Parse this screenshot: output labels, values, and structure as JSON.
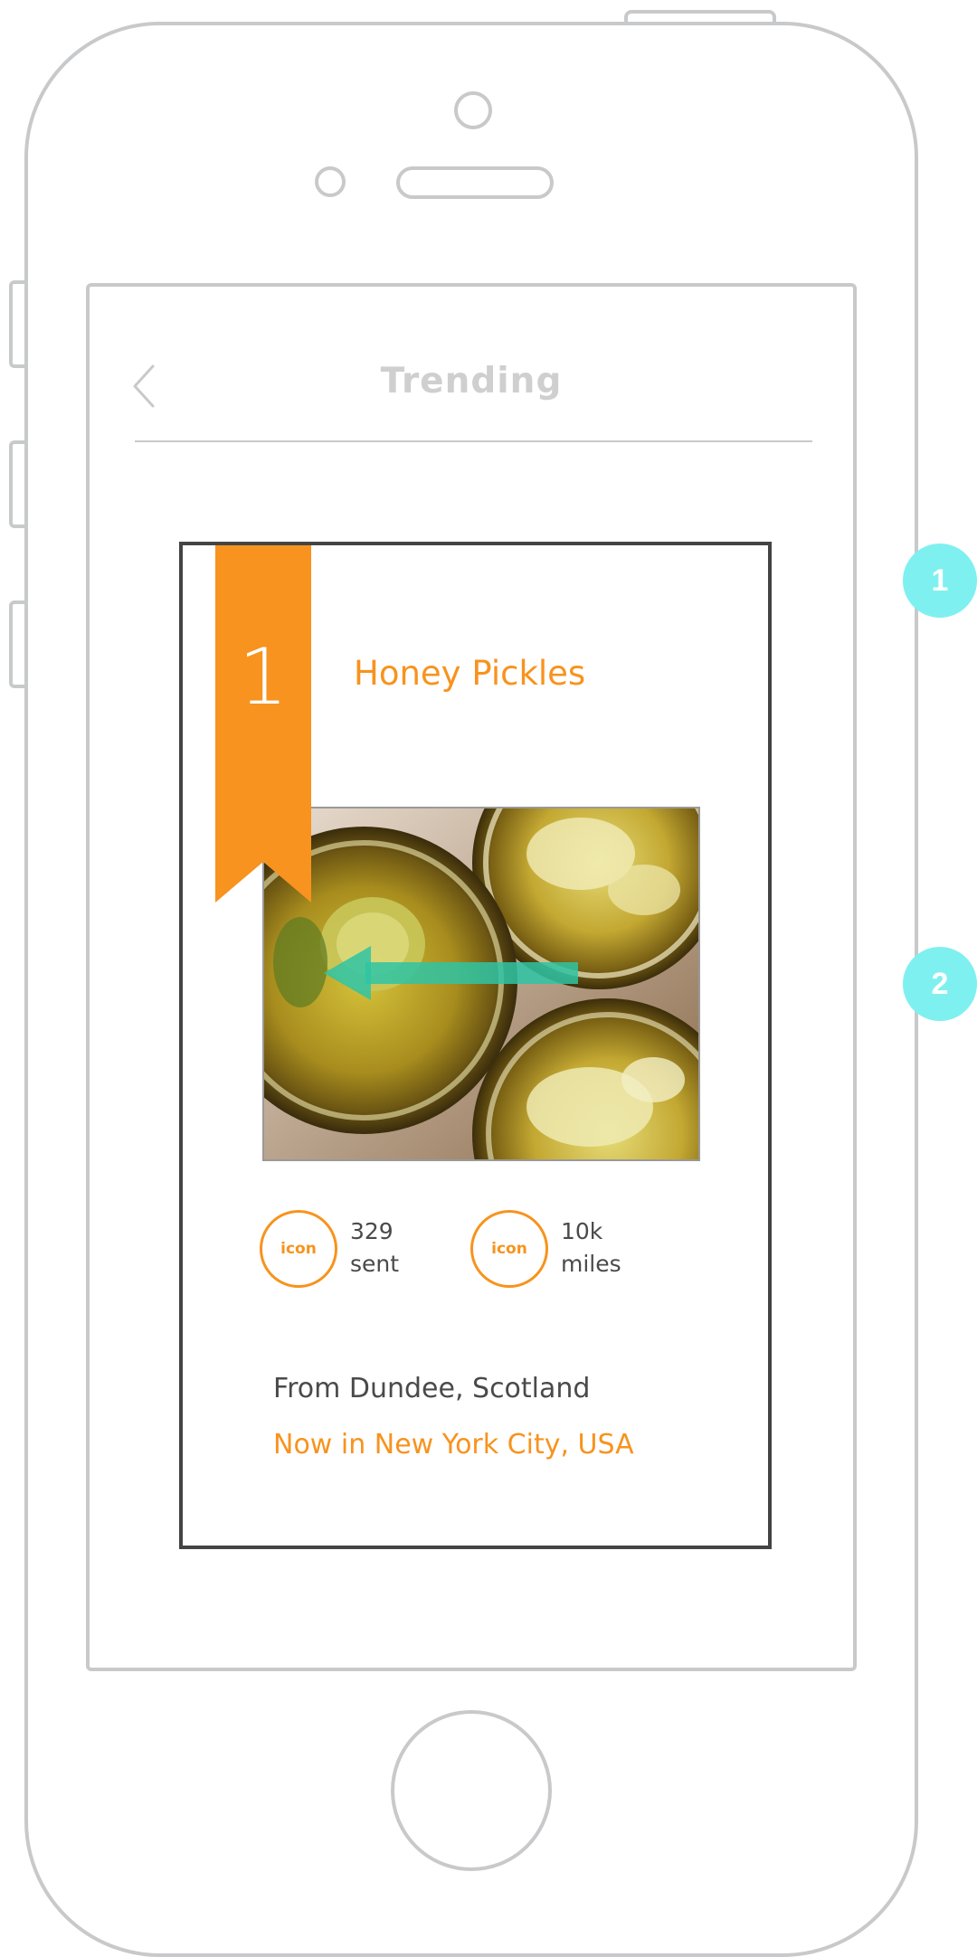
{
  "nav": {
    "title": "Trending",
    "back_icon": "chevron-left-icon"
  },
  "card": {
    "rank": "1",
    "title": "Honey Pickles",
    "photo_subject": "jars of honey pickles",
    "stats": [
      {
        "icon_label": "icon",
        "value": "329",
        "unit": "sent"
      },
      {
        "icon_label": "icon",
        "value": "10k",
        "unit": "miles"
      }
    ],
    "origin": "From Dundee, Scotland",
    "current_location": "Now in New York City, USA"
  },
  "annotations": [
    {
      "label": "1"
    },
    {
      "label": "2"
    }
  ],
  "colors": {
    "accent": "#f7931e",
    "frame": "#c8c9cb",
    "marker": "#7ff0f0",
    "arrow": "#2ec4a5",
    "text": "#4a4a4a"
  }
}
